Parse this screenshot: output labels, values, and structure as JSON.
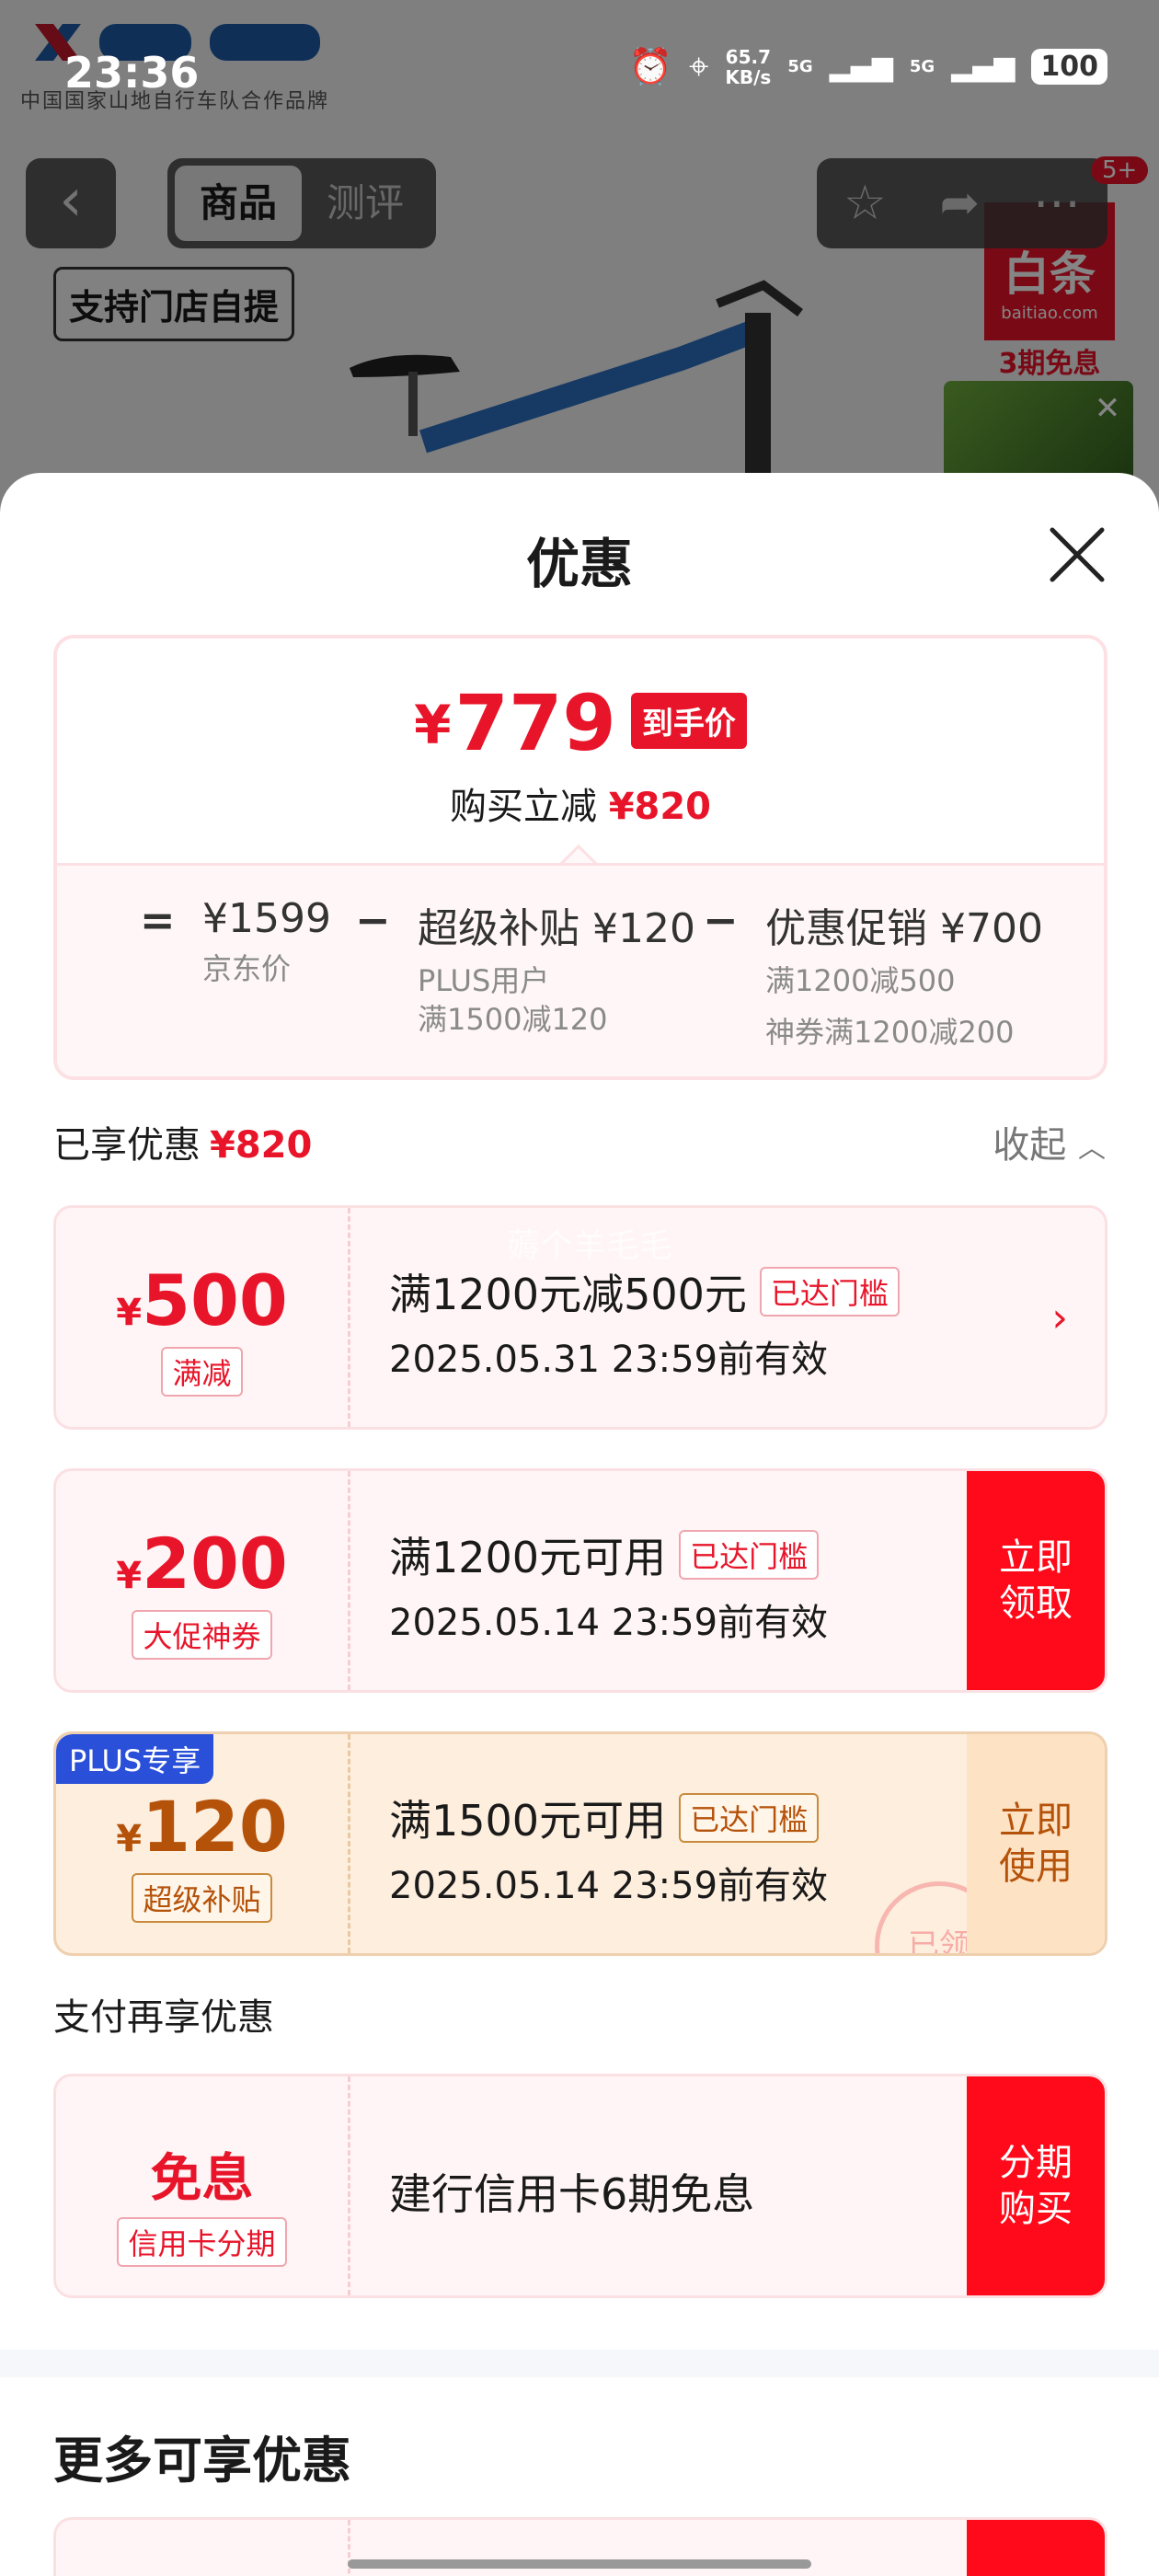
{
  "status_bar": {
    "time": "23:36",
    "speed_value": "65.7",
    "speed_unit": "KB/s",
    "signal1": "5G",
    "signal2": "5G",
    "battery": "100"
  },
  "background": {
    "brand_sub": "中国国家山地自行车队合作品牌",
    "pickup_tag": "支持门店自提",
    "ad_main": "白条",
    "ad_url": "baitiao.com",
    "ad_tag": "3期免息"
  },
  "nav": {
    "tabs": [
      {
        "label": "商品",
        "active": true
      },
      {
        "label": "测评",
        "active": false
      }
    ],
    "badge": "5+"
  },
  "sheet": {
    "title": "优惠",
    "summary": {
      "currency": "¥",
      "final_price": "779",
      "final_tag": "到手价",
      "reduce_label": "购买立减",
      "reduce_amount": "¥820",
      "eq": "=",
      "minus": "−",
      "jd_price": "¥1599",
      "jd_label": "京东价",
      "subsidy": "超级补贴 ¥120",
      "subsidy_sub1": "PLUS用户",
      "subsidy_sub2": "满1500减120",
      "promo": "优惠促销 ¥700",
      "promo_sub1": "满1200减500",
      "promo_sub2": "神券满1200减200"
    },
    "enjoyed_label": "已享优惠",
    "enjoyed_amount": "¥820",
    "collapse_label": "收起",
    "watermark": "薅个羊毛毛",
    "coupons": [
      {
        "currency": "¥",
        "amount": "500",
        "kind": "满减",
        "condition": "满1200元减500元",
        "reach": "已达门槛",
        "valid": "2025.05.31 23:59前有效"
      },
      {
        "currency": "¥",
        "amount": "200",
        "kind": "大促神券",
        "condition": "满1200元可用",
        "reach": "已达门槛",
        "valid": "2025.05.14 23:59前有效",
        "action": "立即领取"
      },
      {
        "badge": "PLUS专享",
        "currency": "¥",
        "amount": "120",
        "kind": "超级补贴",
        "condition": "满1500元可用",
        "reach": "已达门槛",
        "valid": "2025.05.14 23:59前有效",
        "action": "立即使用",
        "stamp": "已领"
      }
    ],
    "pay_label": "支付再享优惠",
    "pay_card": {
      "amount": "免息",
      "kind": "信用卡分期",
      "text": "建行信用卡6期免息",
      "action": "分期购买"
    },
    "more_title": "更多可享优惠"
  },
  "colors": {
    "accent_red": "#e8152a",
    "action_red": "#ff0a1a",
    "gold_text": "#b5520a",
    "plus_blue": "#2a4fd8"
  }
}
